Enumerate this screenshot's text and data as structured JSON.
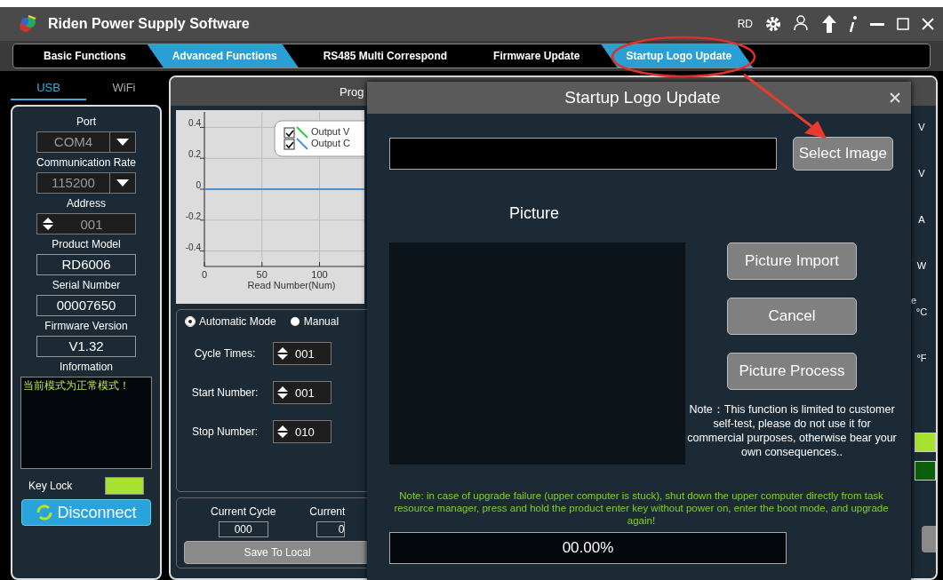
{
  "window": {
    "title": "Riden Power Supply Software",
    "toolbar_label": "RD"
  },
  "tabs": [
    {
      "label": "Basic Functions",
      "selected": false
    },
    {
      "label": "Advanced Functions",
      "selected": true
    },
    {
      "label": "RS485 Multi Correspond",
      "selected": false
    },
    {
      "label": "Firmware Update",
      "selected": false
    },
    {
      "label": "Startup Logo Update",
      "selected": true
    }
  ],
  "connection": {
    "tabs": [
      {
        "label": "USB",
        "selected": true
      },
      {
        "label": "WiFi",
        "selected": false
      }
    ],
    "fields": [
      {
        "label": "Port",
        "value": "COM4",
        "kind": "dropdown"
      },
      {
        "label": "Communication Rate",
        "value": "115200",
        "kind": "dropdown"
      },
      {
        "label": "Address",
        "value": "001",
        "kind": "spinner"
      },
      {
        "label": "Product Model",
        "value": "RD6006",
        "kind": "display"
      },
      {
        "label": "Serial Number",
        "value": "00007650",
        "kind": "display"
      },
      {
        "label": "Firmware Version",
        "value": "V1.32",
        "kind": "display"
      }
    ],
    "information": {
      "label": "Information",
      "log": "当前模式为正常模式！"
    },
    "key_lock": {
      "label": "Key Lock",
      "on": true
    },
    "disconnect_button": "Disconnect"
  },
  "program_panel": {
    "title": "Prog",
    "chart_data": {
      "type": "line",
      "grid": true,
      "legend": true,
      "xlabel": "Read Number(Num)",
      "x": [
        0,
        139
      ],
      "xlim": [
        0,
        139
      ],
      "ylim": [
        -0.5,
        0.5
      ],
      "xticks": [
        0,
        50,
        100
      ],
      "yticks": [
        0.4,
        0.2,
        0,
        -0.2,
        -0.4
      ],
      "series": [
        {
          "name": "Output V",
          "color": "#2ecc40",
          "values": [
            null,
            null
          ]
        },
        {
          "name": "Output C",
          "color": "#4a90d9",
          "values": [
            0,
            0
          ]
        }
      ]
    },
    "legend_checked": [
      true,
      true
    ],
    "modes": [
      {
        "label": "Automatic Mode",
        "selected": true
      },
      {
        "label": "Manual",
        "selected": false
      }
    ],
    "settings": [
      {
        "label": "Cycle Times:",
        "value": "001"
      },
      {
        "label": "Start Number:",
        "value": "001"
      },
      {
        "label": "Stop Number:",
        "value": "010"
      }
    ],
    "counters": [
      {
        "label": "Current Cycle",
        "value": "000"
      },
      {
        "label": "Current",
        "value": "0"
      }
    ],
    "save_button": "Save To Local"
  },
  "side_units": [
    "V",
    "V",
    "A",
    "W",
    "°C",
    "°F"
  ],
  "side_fragment": "e",
  "side_indicators": [
    {
      "color": "#a6e22e"
    },
    {
      "color": "#0b5d0b"
    }
  ],
  "dialog": {
    "title": "Startup Logo Update",
    "select_button": "Select Image",
    "picture_label": "Picture",
    "buttons": [
      "Picture Import",
      "Cancel",
      "Picture Process"
    ],
    "note": "Note：This function is limited to customer self-test, please do not use it for commercial purposes, otherwise bear your own consequences..",
    "warning": "Note: in case of upgrade failure (upper computer is stuck), shut down the upper computer directly from task resource manager, press and hold the product enter key without power on, enter the boot mode, and upgrade again!",
    "progress": "00.00%"
  }
}
